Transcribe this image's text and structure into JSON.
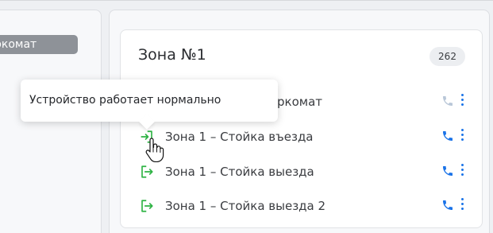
{
  "left_panel": {
    "badge_label": "ркомат"
  },
  "zone": {
    "title": "Зона №1",
    "count": "262",
    "devices": [
      {
        "name": "ркомат",
        "icon": "parking-machine-icon",
        "phone_active": false
      },
      {
        "name": "Зона 1 – Стойка въезда",
        "icon": "entry-icon",
        "phone_active": true
      },
      {
        "name": "Зона 1 – Стойка выезда",
        "icon": "exit-icon",
        "phone_active": true
      },
      {
        "name": "Зона 1 – Стойка выезда 2",
        "icon": "exit-icon",
        "phone_active": true
      }
    ]
  },
  "tooltip": {
    "text": "Устройство работает нормально"
  },
  "colors": {
    "accent_blue": "#1a73e8",
    "status_green": "#2fb344",
    "phone_inactive": "#b9c7d8"
  }
}
